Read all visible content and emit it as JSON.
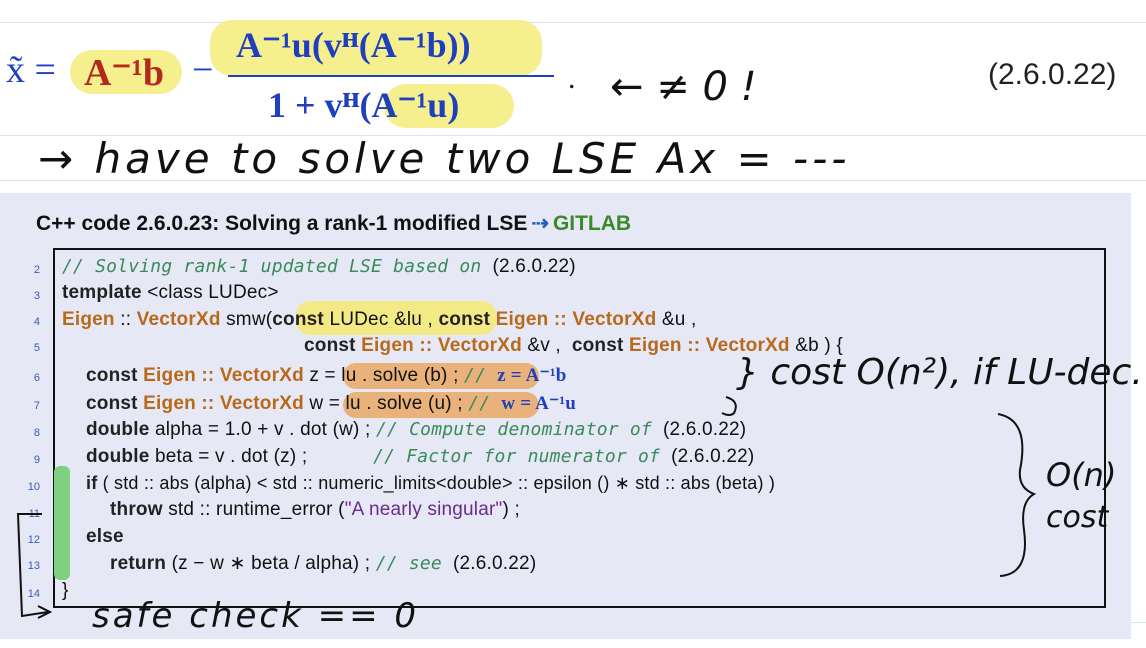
{
  "formula": {
    "lhs": "x̃ =",
    "term1": "A⁻¹b",
    "minus": "−",
    "numerator": "A⁻¹u(vᴴ(A⁻¹b))",
    "denominator": "1 + vᴴ(A⁻¹u)",
    "dot": ".",
    "eq_number": "(2.6.0.22)"
  },
  "handwriting": {
    "note1": "← ≠ 0 !",
    "note2": "→ have to solve two LSE Ax = ---",
    "note3": "} cost O(n²), if LU-dec.",
    "note4": "O(n)",
    "note5": "cost",
    "note6": "safe check == 0"
  },
  "code_block": {
    "title": "C++ code 2.6.0.23: Solving a rank-1 modified LSE",
    "link_arrow": "⇢",
    "link": "GITLAB",
    "line_numbers": [
      "2",
      "3",
      "4",
      "5",
      "6",
      "7",
      "8",
      "9",
      "10",
      "11",
      "12",
      "13",
      "14"
    ],
    "lines": {
      "l2_comment": "// Solving rank-1 updated LSE based on ",
      "l2_ref": "(2.6.0.22)",
      "l3_kw": "template",
      "l3_rest": " <class LUDec>",
      "l4_type": "Eigen",
      "l4_sep": " :: ",
      "l4_type2": "VectorXd",
      "l4_fn": " smw(",
      "l4_kw": "const",
      "l4_rest": " LUDec &lu , ",
      "l4_kw2": "const",
      "l4_type3": " Eigen :: VectorXd",
      "l4_end": " &u ,",
      "l5_kw": "const",
      "l5_type": " Eigen :: VectorXd",
      "l5_mid": " &v ,  ",
      "l5_kw2": "const",
      "l5_type2": " Eigen :: VectorXd",
      "l5_end": " &b ) {",
      "l6_kw": "const",
      "l6_type": " Eigen :: VectorXd",
      "l6_rest": " z = lu . solve (b) ; ",
      "l6_comment": "// ",
      "l6_math": "z = A⁻¹b",
      "l7_kw": "const",
      "l7_type": " Eigen :: VectorXd",
      "l7_rest": " w = lu . solve (u) ; ",
      "l7_comment": "// ",
      "l7_math": "w = A⁻¹u",
      "l8_kw": "double",
      "l8_rest": " alpha = 1.0 + v . dot (w) ; ",
      "l8_comment": "// Compute denominator of ",
      "l8_ref": "(2.6.0.22)",
      "l9_kw": "double",
      "l9_rest": " beta = v . dot (z) ;            ",
      "l9_comment": "// Factor for numerator of ",
      "l9_ref": "(2.6.0.22)",
      "l10_kw": "if",
      "l10_rest": " ( std :: abs (alpha) < std :: numeric_limits<double> :: epsilon () ∗ std :: abs (beta) )",
      "l11_kw": "throw",
      "l11_rest": " std :: runtime_error (",
      "l11_str": "\"A nearly singular\"",
      "l11_end": ") ;",
      "l12_kw": "else",
      "l13_kw": "return",
      "l13_rest": " (z − w ∗ beta / alpha) ; ",
      "l13_comment": "// see ",
      "l13_ref": "(2.6.0.22)",
      "l14": "}"
    }
  },
  "colors": {
    "highlight_yellow": "#f6ef8e",
    "highlight_orange": "#e8b27a",
    "panel_bg": "#e6e8f6",
    "math_blue": "#1f3fbf",
    "math_red": "#b22a1e",
    "link_green": "#3a8a2a"
  }
}
